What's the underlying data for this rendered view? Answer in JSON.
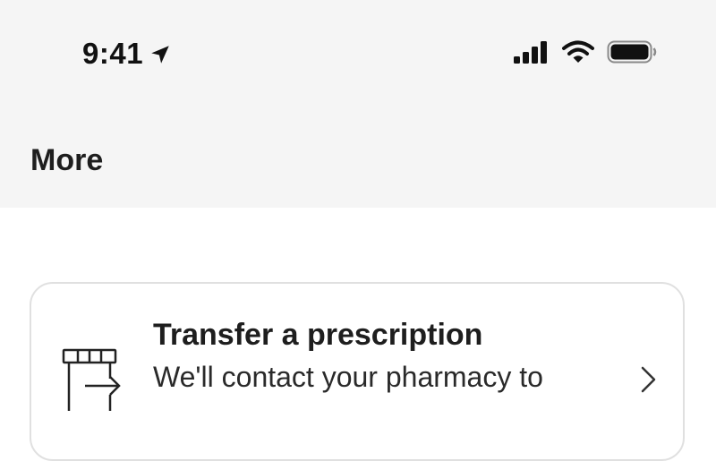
{
  "status_bar": {
    "time": "9:41",
    "icons": [
      "location-arrow-icon",
      "cellular-signal-icon",
      "wifi-icon",
      "battery-icon"
    ]
  },
  "header": {
    "title": "More"
  },
  "items": [
    {
      "title": "Transfer a prescription",
      "description": "We'll contact your pharmacy to",
      "icon": "prescription-transfer-icon",
      "trailing_icon": "chevron-right-icon"
    }
  ],
  "colors": {
    "header_bg": "#f5f5f5",
    "page_bg": "#ffffff",
    "text": "#1e1e1e",
    "card_border": "#e0e0e0"
  }
}
